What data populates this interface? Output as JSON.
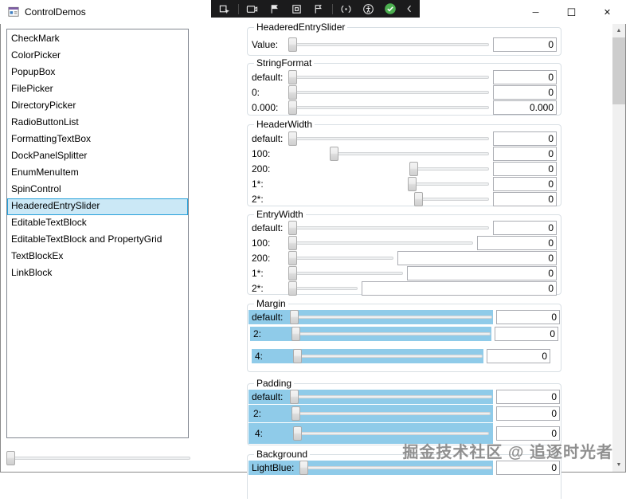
{
  "window": {
    "title": "ControlDemos",
    "controls": {
      "minimize": "─",
      "maximize": "☐",
      "close": "✕"
    }
  },
  "debug_toolbar": {
    "icons": [
      "select-element",
      "screen-capture",
      "flag-element",
      "layout-box",
      "flag-pin",
      "hot-reload",
      "accessibility-checker",
      "hot-reload-enabled",
      "collapse-toolbar"
    ]
  },
  "sidebar": {
    "items": [
      "CheckMark",
      "ColorPicker",
      "PopupBox",
      "FilePicker",
      "DirectoryPicker",
      "RadioButtonList",
      "FormattingTextBox",
      "DockPanelSplitter",
      "EnumMenuItem",
      "SpinControl",
      "HeaderedEntrySlider",
      "EditableTextBlock",
      "EditableTextBlock and PropertyGrid",
      "TextBlockEx",
      "LinkBlock"
    ],
    "selected": "HeaderedEntrySlider",
    "selected_index": 10
  },
  "groups": {
    "headered_entry_slider": {
      "title": "HeaderedEntrySlider",
      "rows": [
        {
          "label": "Value:",
          "value": "0"
        }
      ]
    },
    "string_format": {
      "title": "StringFormat",
      "rows": [
        {
          "label": "default:",
          "value": "0"
        },
        {
          "label": "0:",
          "value": "0"
        },
        {
          "label": "0.000:",
          "value": "0.000"
        }
      ]
    },
    "header_width": {
      "title": "HeaderWidth",
      "rows": [
        {
          "label": "default:",
          "value": "0"
        },
        {
          "label": "100:",
          "value": "0"
        },
        {
          "label": "200:",
          "value": "0"
        },
        {
          "label": "1*:",
          "value": "0"
        },
        {
          "label": "2*:",
          "value": "0"
        }
      ]
    },
    "entry_width": {
      "title": "EntryWidth",
      "rows": [
        {
          "label": "default:",
          "value": "0"
        },
        {
          "label": "100:",
          "value": "0"
        },
        {
          "label": "200:",
          "value": "0"
        },
        {
          "label": "1*:",
          "value": "0"
        },
        {
          "label": "2*:",
          "value": "0"
        }
      ]
    },
    "margin": {
      "title": "Margin",
      "rows": [
        {
          "label": "default:",
          "value": "0"
        },
        {
          "label": "2:",
          "value": "0"
        },
        {
          "label": "4:",
          "value": "0"
        }
      ]
    },
    "padding": {
      "title": "Padding",
      "rows": [
        {
          "label": "default:",
          "value": "0"
        },
        {
          "label": "2:",
          "value": "0"
        },
        {
          "label": "4:",
          "value": "0"
        }
      ]
    },
    "background": {
      "title": "Background",
      "rows": [
        {
          "label": "LightBlue:",
          "value": "0"
        }
      ]
    }
  },
  "slider_state": {
    "all_values_at": 0
  },
  "watermark": "掘金技术社区 @ 追逐时光者",
  "colors": {
    "highlight_blue": "#8FCBE9",
    "selection_fill": "#CBE8F6",
    "selection_border": "#26A0DA",
    "check_green": "#4CAF50",
    "toolbar_bg": "#1B1B1C",
    "group_border": "#D8DFE4"
  }
}
